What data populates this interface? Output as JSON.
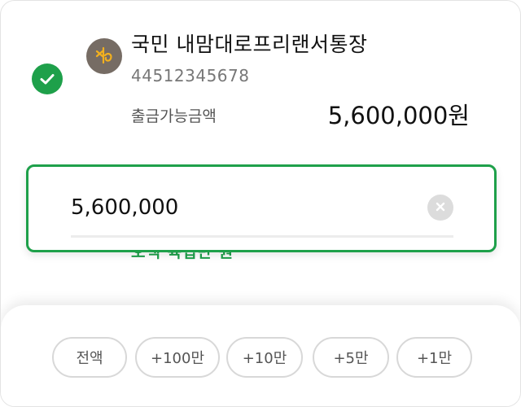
{
  "account": {
    "bank_icon": "kb-bank-logo-icon",
    "name": "국민  내맘대로프리랜서통장",
    "number": "44512345678",
    "balance_label": "출금가능금액",
    "balance_value": "5,600,000원"
  },
  "amount": {
    "value": "5,600,000",
    "korean_text": "오백 육십만 원"
  },
  "quick_buttons": [
    "전액",
    "+100만",
    "+10만",
    "+5만",
    "+1만"
  ],
  "colors": {
    "accent": "#1ea04a",
    "bank_logo_bg": "#766c64",
    "bank_logo_fg": "#f2b01e"
  }
}
